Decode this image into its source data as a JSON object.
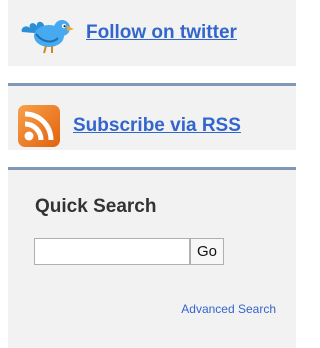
{
  "twitter": {
    "label": "Follow on twitter",
    "icon": "twitter-bird-icon"
  },
  "rss": {
    "label": "Subscribe via RSS",
    "icon": "rss-feed-icon"
  },
  "quick_search": {
    "title": "Quick Search",
    "input_value": "",
    "button_label": "Go",
    "advanced_link": "Advanced Search"
  },
  "colors": {
    "link": "#3366cc",
    "panel_background": "#f2f2f2",
    "panel_border": "#8197b7",
    "rss_orange": "#f0761a"
  }
}
